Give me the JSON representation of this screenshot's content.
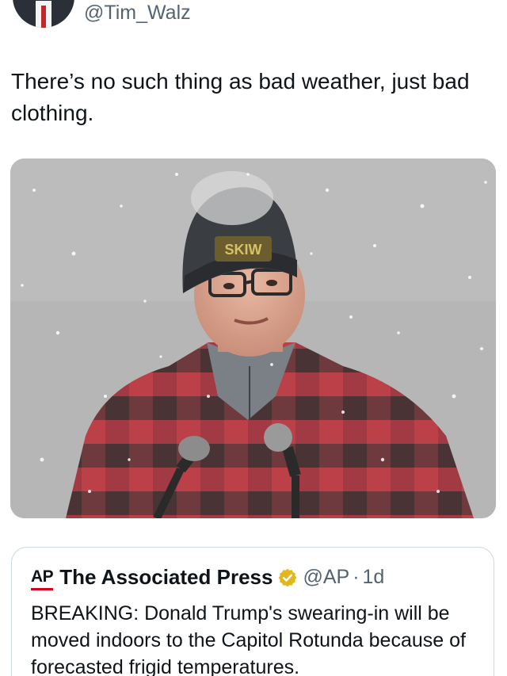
{
  "author": {
    "handle": "@Tim_Walz"
  },
  "tweet": {
    "text": "There’s no such thing as bad weather, just bad clothing."
  },
  "media": {
    "icon": "photo-man-in-snow",
    "colors": {
      "background": "#b3b3b3",
      "plaid_red": "#b3262f",
      "plaid_dark": "#2a1e22"
    }
  },
  "quoted_tweet": {
    "logo_text": "AP",
    "name": "The Associated Press",
    "handle": "@AP",
    "separator": "·",
    "time": "1d",
    "verified_color": "#e2b719",
    "text": "BREAKING: Donald Trump's swearing-in will be moved indoors to the Capitol Rotunda because of forecasted frigid temperatures."
  }
}
